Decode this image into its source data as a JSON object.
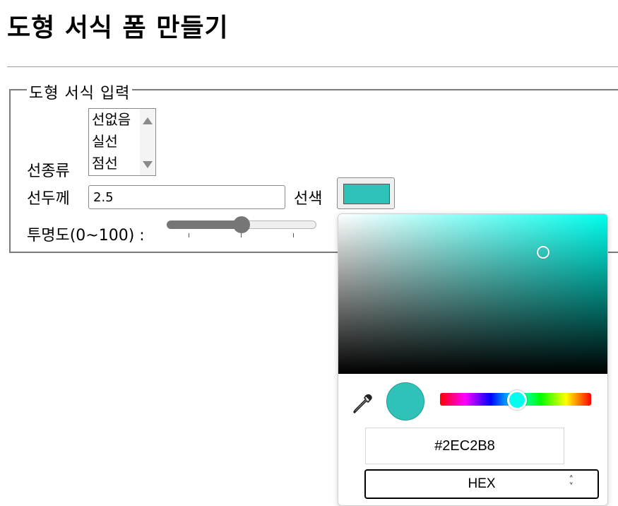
{
  "page": {
    "title": "도형 서식 폼 만들기"
  },
  "form": {
    "legend": "도형 서식 입력",
    "line_type": {
      "label": "선종류",
      "options": [
        "선없음",
        "실선",
        "점선"
      ]
    },
    "line_width": {
      "label": "선두께",
      "value": "2.5"
    },
    "line_color": {
      "label": "선색",
      "value": "#2EC2B8"
    },
    "opacity": {
      "label": "투명도(0~100) :",
      "value": 50,
      "min": 0,
      "max": 100
    }
  },
  "color_picker": {
    "base_hue_color": "#00FFEE",
    "selected_color": "#2EC2B8",
    "hex_value": "#2EC2B8",
    "mode": "HEX",
    "saturation": 0.76,
    "brightness": 0.76,
    "hue_fraction": 0.51
  },
  "icons": {
    "eyedropper": "eyedropper-icon",
    "mode_chevron": "chevron-updown-icon"
  }
}
